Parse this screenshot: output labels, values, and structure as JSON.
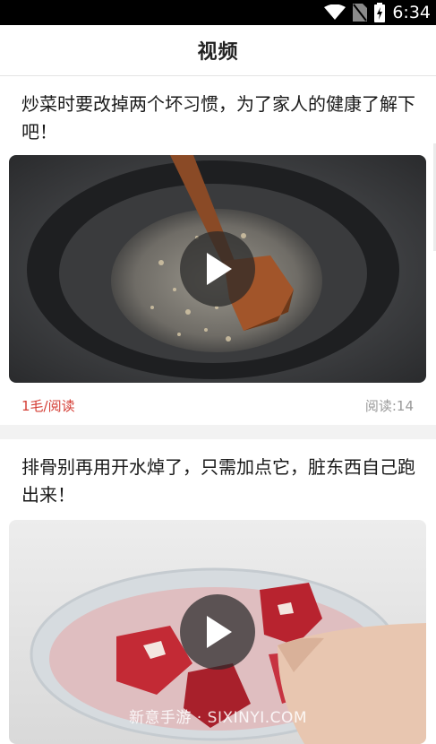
{
  "status_bar": {
    "time": "6:34",
    "icons": [
      "wifi-icon",
      "no-sim-icon",
      "battery-icon"
    ]
  },
  "header": {
    "title": "视频"
  },
  "articles": [
    {
      "title": "炒菜时要改掉两个坏习惯，为了家人的健康了解下吧！",
      "reward": "1毛/阅读",
      "reads": "阅读:14",
      "thumbnail": "pan-frying-video",
      "play_icon": "play-icon"
    },
    {
      "title": "排骨别再用开水焯了，只需加点它，脏东西自己跑出来！",
      "thumbnail": "raw-ribs-bowl-video",
      "play_icon": "play-icon"
    }
  ],
  "watermark": "新意手游 · SIXINYI.COM",
  "colors": {
    "accent_red": "#d43c33",
    "meta_gray": "#9a9a9a",
    "divider": "#f2f2f2",
    "status_bar": "#000000"
  }
}
